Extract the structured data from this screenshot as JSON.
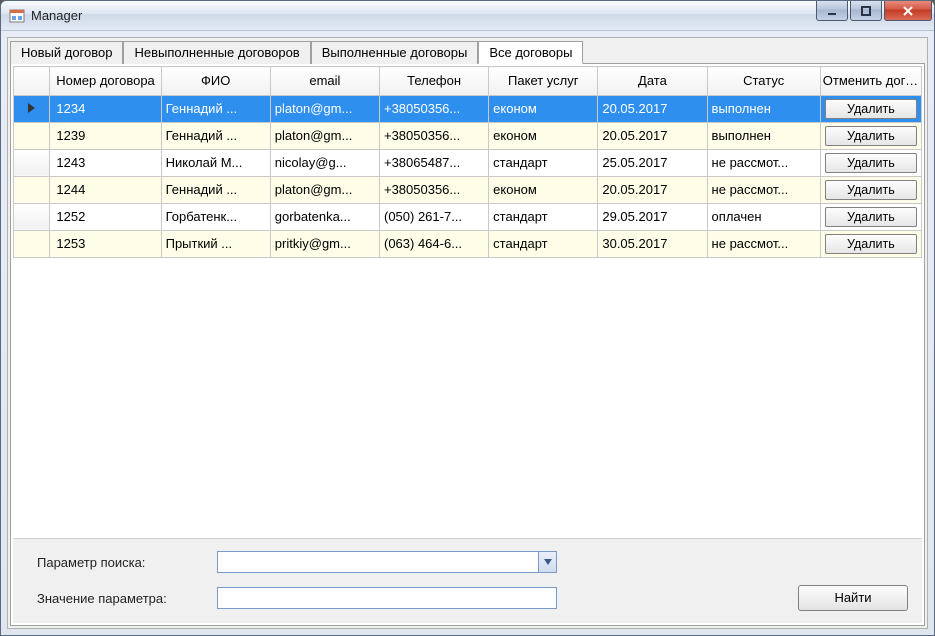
{
  "window": {
    "title": "Manager"
  },
  "tabs": [
    {
      "label": "Новый договор",
      "active": false
    },
    {
      "label": "Невыполненные договоров",
      "active": false
    },
    {
      "label": "Выполненные договоры",
      "active": false
    },
    {
      "label": "Все договоры",
      "active": true
    }
  ],
  "grid": {
    "headers": {
      "number": "Номер договора",
      "fio": "ФИО",
      "email": "email",
      "phone": "Телефон",
      "package": "Пакет услуг",
      "date": "Дата",
      "status": "Статус",
      "cancel": "Отменить договор"
    },
    "delete_label": "Удалить",
    "rows": [
      {
        "number": "1234",
        "fio": "Геннадий ...",
        "email": "platon@gm...",
        "phone": "+38050356...",
        "package": "економ",
        "date": "20.05.2017",
        "status": "выполнен",
        "selected": true
      },
      {
        "number": "1239",
        "fio": "Геннадий ...",
        "email": "platon@gm...",
        "phone": "+38050356...",
        "package": "економ",
        "date": "20.05.2017",
        "status": "выполнен",
        "alt": true
      },
      {
        "number": "1243",
        "fio": "Николай М...",
        "email": "nicolay@g...",
        "phone": "+38065487...",
        "package": "стандарт",
        "date": "25.05.2017",
        "status": "не рассмот..."
      },
      {
        "number": "1244",
        "fio": "Геннадий ...",
        "email": "platon@gm...",
        "phone": "+38050356...",
        "package": "економ",
        "date": "20.05.2017",
        "status": "не рассмот...",
        "alt": true
      },
      {
        "number": "1252",
        "fio": "Горбатенк...",
        "email": "gorbatenka...",
        "phone": "(050) 261-7...",
        "package": "стандарт",
        "date": "29.05.2017",
        "status": "оплачен"
      },
      {
        "number": "1253",
        "fio": "Прыткий ...",
        "email": "pritkiy@gm...",
        "phone": "(063) 464-6...",
        "package": "стандарт",
        "date": "30.05.2017",
        "status": "не рассмот...",
        "alt": true
      }
    ]
  },
  "search": {
    "param_label": "Параметр поиска:",
    "value_label": "Значение параметра:",
    "combo_value": "",
    "text_value": "",
    "find_label": "Найти"
  }
}
